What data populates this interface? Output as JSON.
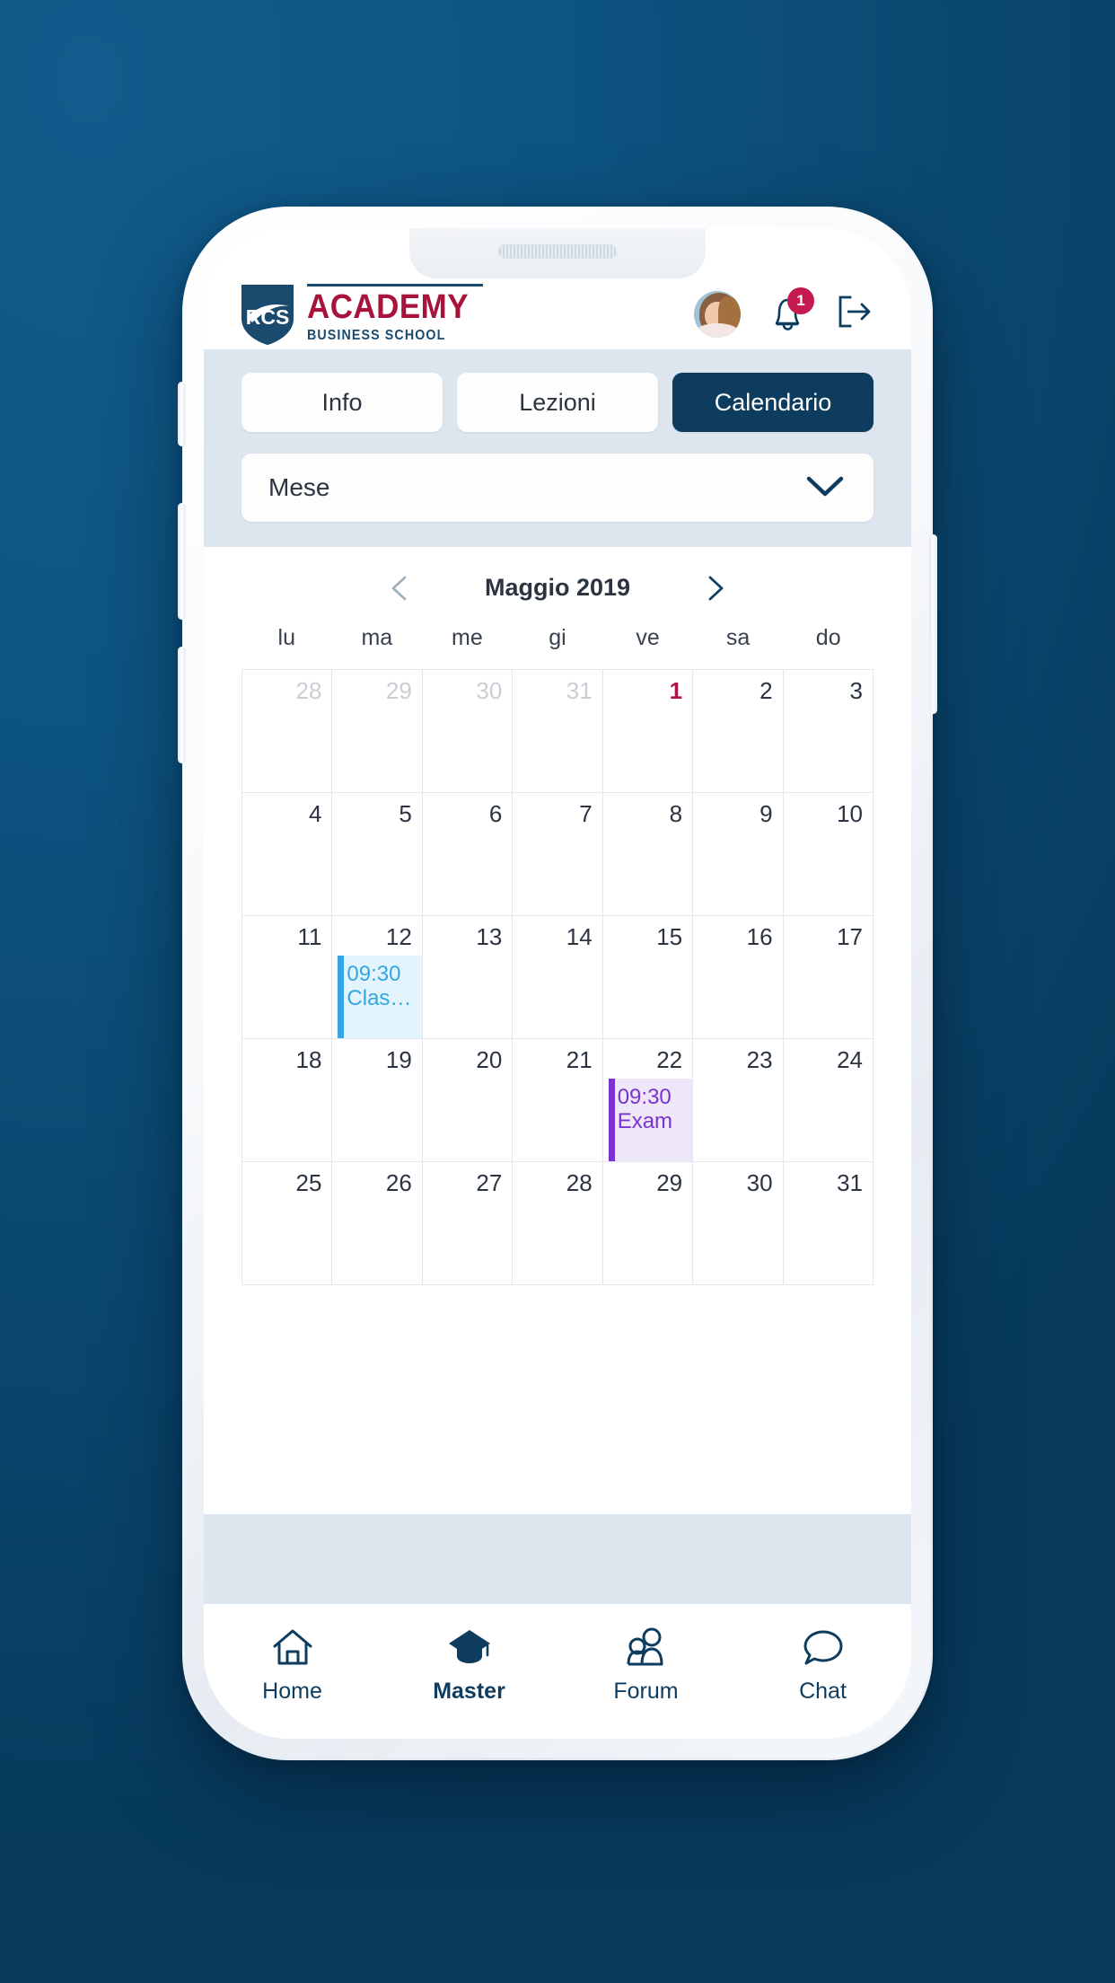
{
  "theme": {
    "page_background": "#0d5380",
    "brand_navy": "#0d3c5e",
    "brand_crimson": "#a8133c",
    "accent_blue": "#33a6e3",
    "accent_purple": "#7a33cf",
    "today_red": "#b01445",
    "strip_background": "#dde5ee"
  },
  "header": {
    "logo": {
      "shield_text": "RCS",
      "brand_main": "ACADEMY",
      "brand_sub": "BUSINESS SCHOOL"
    },
    "avatar_name": "avatar",
    "notification_count": "1",
    "logout_label": "logout"
  },
  "tabs": [
    {
      "label": "Info",
      "active": false
    },
    {
      "label": "Lezioni",
      "active": false
    },
    {
      "label": "Calendario",
      "active": true
    }
  ],
  "view_select": {
    "value": "Mese",
    "placeholder": "Mese"
  },
  "calendar": {
    "month_label": "Maggio 2019",
    "prev_label": "‹",
    "next_label": "›",
    "weekdays": [
      "lu",
      "ma",
      "me",
      "gi",
      "ve",
      "sa",
      "do"
    ],
    "weeks": [
      [
        {
          "day": "28",
          "out": true
        },
        {
          "day": "29",
          "out": true
        },
        {
          "day": "30",
          "out": true
        },
        {
          "day": "31",
          "out": true
        },
        {
          "day": "1",
          "today": true
        },
        {
          "day": "2"
        },
        {
          "day": "3"
        }
      ],
      [
        {
          "day": "4"
        },
        {
          "day": "5"
        },
        {
          "day": "6"
        },
        {
          "day": "7"
        },
        {
          "day": "8"
        },
        {
          "day": "9"
        },
        {
          "day": "10"
        }
      ],
      [
        {
          "day": "11"
        },
        {
          "day": "12",
          "event": {
            "time": "09:30",
            "title": "Clas…",
            "color": "blue"
          }
        },
        {
          "day": "13"
        },
        {
          "day": "14"
        },
        {
          "day": "15"
        },
        {
          "day": "16"
        },
        {
          "day": "17"
        }
      ],
      [
        {
          "day": "18"
        },
        {
          "day": "19"
        },
        {
          "day": "20"
        },
        {
          "day": "21"
        },
        {
          "day": "22",
          "event": {
            "time": "09:30",
            "title": "Exam",
            "color": "purple"
          }
        },
        {
          "day": "23"
        },
        {
          "day": "24"
        }
      ],
      [
        {
          "day": "25"
        },
        {
          "day": "26"
        },
        {
          "day": "27"
        },
        {
          "day": "28"
        },
        {
          "day": "29"
        },
        {
          "day": "30"
        },
        {
          "day": "31"
        }
      ]
    ]
  },
  "bottom_nav": [
    {
      "label": "Home",
      "icon": "home-icon",
      "active": false
    },
    {
      "label": "Master",
      "icon": "graduation-cap-icon",
      "active": true
    },
    {
      "label": "Forum",
      "icon": "people-icon",
      "active": false
    },
    {
      "label": "Chat",
      "icon": "chat-bubble-icon",
      "active": false
    }
  ]
}
